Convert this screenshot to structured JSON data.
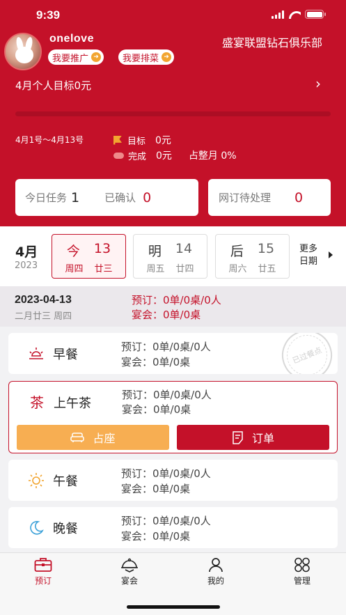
{
  "status_bar": {
    "time": "9:39"
  },
  "profile": {
    "username": "onelove",
    "promote_label": "我要推广",
    "rank_label": "我要排菜",
    "club_name": "盛宴联盟钻石俱乐部"
  },
  "goal": {
    "title": "4月个人目标0元",
    "progress_fraction": 0,
    "date_range": "4月1号～4月13号",
    "target_label": "目标",
    "target_value": "0元",
    "done_label": "完成",
    "done_value": "0元",
    "share_text": "占整月 0%"
  },
  "tasks": {
    "today_label": "今日任务",
    "today_value": "1",
    "confirmed_label": "已确认",
    "confirmed_value": "0",
    "online_label": "网订待处理",
    "online_value": "0"
  },
  "calendar": {
    "month": "4月",
    "year": "2023",
    "days": [
      {
        "word": "今",
        "date": "13",
        "weekday": "周四",
        "lunar": "廿三",
        "selected": true
      },
      {
        "word": "明",
        "date": "14",
        "weekday": "周五",
        "lunar": "廿四",
        "selected": false
      },
      {
        "word": "后",
        "date": "15",
        "weekday": "周六",
        "lunar": "廿五",
        "selected": false
      }
    ],
    "more_line1": "更多",
    "more_line2": "日期"
  },
  "day_summary": {
    "date": "2023-04-13",
    "lunar": "二月廿三  周四",
    "booking": "预订：0单/0桌/0人",
    "banquet": "宴会：0单/0桌"
  },
  "meals": [
    {
      "name": "早餐",
      "icon": "sunrise-icon",
      "booking": "预订：0单/0桌/0人",
      "banquet": "宴会：0单/0桌",
      "stamp": "已过餐点"
    },
    {
      "name": "上午茶",
      "icon": "tea-icon",
      "icon_char": "茶",
      "booking": "预订：0单/0桌/0人",
      "banquet": "宴会：0单/0桌",
      "seat_label": "占座",
      "order_label": "订单"
    },
    {
      "name": "午餐",
      "icon": "sun-icon",
      "booking": "预订：0单/0桌/0人",
      "banquet": "宴会：0单/0桌"
    },
    {
      "name": "晚餐",
      "icon": "moon-icon",
      "booking": "预订：0单/0桌/0人",
      "banquet": "宴会：0单/0桌"
    }
  ],
  "tabs": [
    {
      "label": "预订",
      "icon": "briefcase-icon",
      "active": true
    },
    {
      "label": "宴会",
      "icon": "cloche-icon",
      "active": false
    },
    {
      "label": "我的",
      "icon": "person-icon",
      "active": false
    },
    {
      "label": "管理",
      "icon": "grid-icon",
      "active": false
    }
  ],
  "colors": {
    "brand_red": "#c41129",
    "accent_orange": "#f7ae52",
    "button_red": "#c41129"
  }
}
